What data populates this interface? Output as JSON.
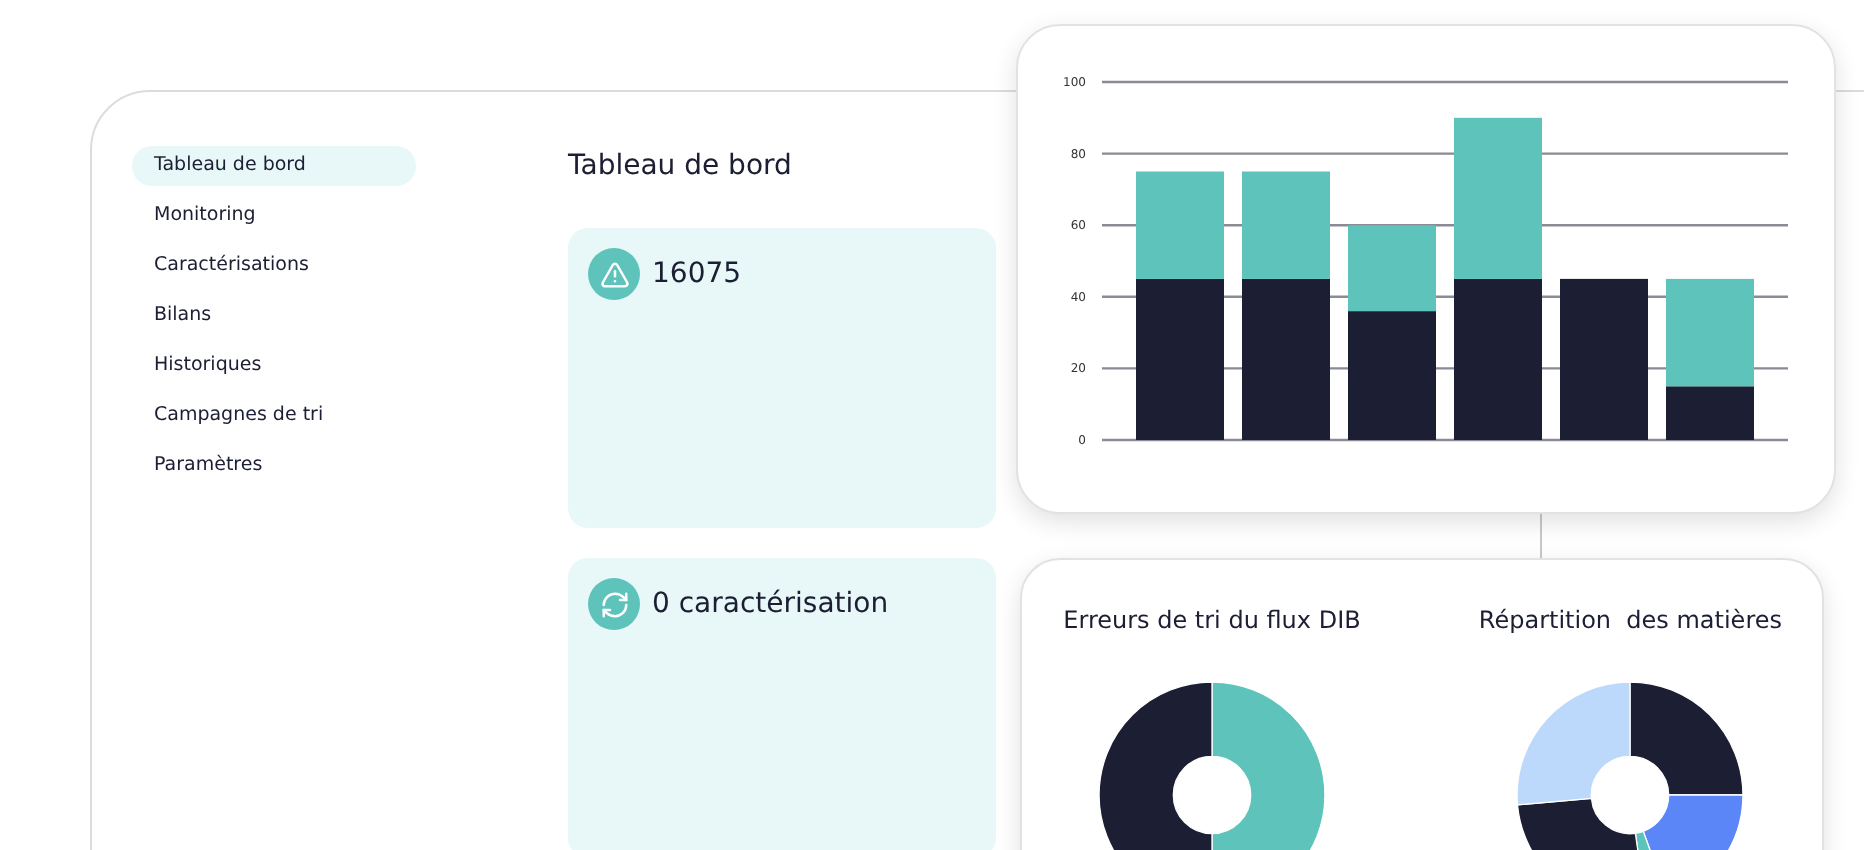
{
  "sidebar": {
    "items": [
      {
        "label": "Tableau de bord",
        "selected": true
      },
      {
        "label": "Monitoring",
        "selected": false
      },
      {
        "label": "Caractérisations",
        "selected": false
      },
      {
        "label": "Bilans",
        "selected": false
      },
      {
        "label": "Historiques",
        "selected": false
      },
      {
        "label": "Campagnes de tri",
        "selected": false
      },
      {
        "label": "Paramètres",
        "selected": false
      }
    ]
  },
  "page_title": "Tableau de bord",
  "stat_cards": [
    {
      "kind": "warning",
      "value": "16075"
    },
    {
      "kind": "refresh",
      "value": "0 caractérisation"
    }
  ],
  "bar_chart": {
    "chart_data": {
      "type": "bar",
      "stacked": true,
      "grid": true,
      "ylim": [
        0,
        100
      ],
      "yticks": [
        0,
        20,
        40,
        60,
        80,
        100
      ],
      "series": [
        {
          "color": "#1c1e33",
          "values": [
            45,
            45,
            36,
            45,
            45,
            15
          ]
        },
        {
          "color": "#5ec3bb",
          "values": [
            30,
            30,
            24,
            45,
            0,
            30
          ]
        }
      ]
    }
  },
  "donut_charts": [
    {
      "kind": "two-part",
      "title": "Erreurs de tri du flux DIB"
    },
    {
      "kind": "multi-part",
      "title": "Répartition  des matières"
    }
  ]
}
